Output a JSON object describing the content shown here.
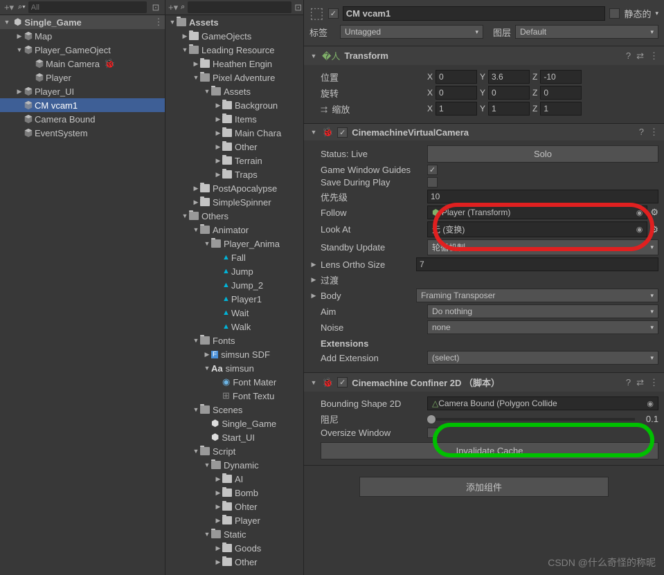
{
  "hierarchy": {
    "search_placeholder": "All",
    "scene": "Single_Game",
    "items": [
      {
        "name": "Map",
        "depth": 1,
        "arrow": "closed"
      },
      {
        "name": "Player_GameOject",
        "depth": 1,
        "arrow": "open"
      },
      {
        "name": "Main Camera",
        "depth": 2,
        "arrow": "none",
        "extra": "🐞"
      },
      {
        "name": "Player",
        "depth": 2,
        "arrow": "none"
      },
      {
        "name": "Player_UI",
        "depth": 1,
        "arrow": "closed"
      },
      {
        "name": "CM vcam1",
        "depth": 1,
        "arrow": "none",
        "selected": true
      },
      {
        "name": "Camera Bound",
        "depth": 1,
        "arrow": "none"
      },
      {
        "name": "EventSystem",
        "depth": 1,
        "arrow": "none"
      }
    ]
  },
  "project": {
    "root": "Assets",
    "tree": [
      {
        "name": "GameOjects",
        "d": 1,
        "a": "closed"
      },
      {
        "name": "Leading Resource",
        "d": 1,
        "a": "open"
      },
      {
        "name": "Heathen Engin",
        "d": 2,
        "a": "closed"
      },
      {
        "name": "Pixel Adventure",
        "d": 2,
        "a": "open"
      },
      {
        "name": "Assets",
        "d": 3,
        "a": "open"
      },
      {
        "name": "Backgroun",
        "d": 4,
        "a": "closed"
      },
      {
        "name": "Items",
        "d": 4,
        "a": "closed"
      },
      {
        "name": "Main Chara",
        "d": 4,
        "a": "closed"
      },
      {
        "name": "Other",
        "d": 4,
        "a": "closed"
      },
      {
        "name": "Terrain",
        "d": 4,
        "a": "closed"
      },
      {
        "name": "Traps",
        "d": 4,
        "a": "closed"
      },
      {
        "name": "PostApocalypse",
        "d": 2,
        "a": "closed"
      },
      {
        "name": "SimpleSpinner",
        "d": 2,
        "a": "closed"
      },
      {
        "name": "Others",
        "d": 1,
        "a": "open"
      },
      {
        "name": "Animator",
        "d": 2,
        "a": "open"
      },
      {
        "name": "Player_Anima",
        "d": 3,
        "a": "open"
      },
      {
        "name": "Fall",
        "d": 4,
        "a": "none",
        "icon": "anim"
      },
      {
        "name": "Jump",
        "d": 4,
        "a": "none",
        "icon": "anim"
      },
      {
        "name": "Jump_2",
        "d": 4,
        "a": "none",
        "icon": "anim"
      },
      {
        "name": "Player1",
        "d": 4,
        "a": "none",
        "icon": "anim"
      },
      {
        "name": "Wait",
        "d": 4,
        "a": "none",
        "icon": "anim"
      },
      {
        "name": "Walk",
        "d": 4,
        "a": "none",
        "icon": "anim"
      },
      {
        "name": "Fonts",
        "d": 2,
        "a": "open"
      },
      {
        "name": "simsun SDF",
        "d": 3,
        "a": "closed",
        "icon": "font"
      },
      {
        "name": "simsun",
        "d": 3,
        "a": "open",
        "icon": "aa"
      },
      {
        "name": "Font Mater",
        "d": 4,
        "a": "none",
        "icon": "mat"
      },
      {
        "name": "Font Textu",
        "d": 4,
        "a": "none",
        "icon": "tex"
      },
      {
        "name": "Scenes",
        "d": 2,
        "a": "open"
      },
      {
        "name": "Single_Game",
        "d": 3,
        "a": "none",
        "icon": "scene"
      },
      {
        "name": "Start_UI",
        "d": 3,
        "a": "none",
        "icon": "scene"
      },
      {
        "name": "Script",
        "d": 2,
        "a": "open"
      },
      {
        "name": "Dynamic",
        "d": 3,
        "a": "open"
      },
      {
        "name": "AI",
        "d": 4,
        "a": "closed"
      },
      {
        "name": "Bomb",
        "d": 4,
        "a": "closed"
      },
      {
        "name": "Ohter",
        "d": 4,
        "a": "closed"
      },
      {
        "name": "Player",
        "d": 4,
        "a": "closed"
      },
      {
        "name": "Static",
        "d": 3,
        "a": "open"
      },
      {
        "name": "Goods",
        "d": 4,
        "a": "closed"
      },
      {
        "name": "Other",
        "d": 4,
        "a": "closed"
      }
    ]
  },
  "inspector": {
    "object_name": "CM vcam1",
    "static_label": "静态的",
    "tag_label": "标签",
    "tag_value": "Untagged",
    "layer_label": "图层",
    "layer_value": "Default",
    "transform": {
      "title": "Transform",
      "pos_label": "位置",
      "rot_label": "旋转",
      "scale_label": "缩放",
      "pos": {
        "x": "0",
        "y": "3.6",
        "z": "-10"
      },
      "rot": {
        "x": "0",
        "y": "0",
        "z": "0"
      },
      "scale": {
        "x": "1",
        "y": "1",
        "z": "1"
      }
    },
    "vcam": {
      "title": "CinemachineVirtualCamera",
      "status_label": "Status: Live",
      "solo": "Solo",
      "guides_label": "Game Window Guides",
      "save_label": "Save During Play",
      "priority_label": "优先级",
      "priority": "10",
      "follow_label": "Follow",
      "follow_value": "Player (Transform)",
      "lookat_label": "Look At",
      "lookat_value": "无 (变换)",
      "standby_label": "Standby Update",
      "standby_value": "轮循机制",
      "lens_label": "Lens Ortho Size",
      "lens_value": "7",
      "transitions_label": "过渡",
      "body_label": "Body",
      "body_value": "Framing Transposer",
      "aim_label": "Aim",
      "aim_value": "Do nothing",
      "noise_label": "Noise",
      "noise_value": "none",
      "ext_title": "Extensions",
      "addext_label": "Add Extension",
      "addext_value": "(select)"
    },
    "confiner": {
      "title": "Cinemachine Confiner 2D （脚本）",
      "bounds_label": "Bounding Shape 2D",
      "bounds_value": "Camera Bound (Polygon Collide",
      "damping_label": "阻尼",
      "damping_value": "0.1",
      "oversize_label": "Oversize Window",
      "invalidate": "Invalidate Cache"
    },
    "add_component": "添加组件"
  },
  "watermark": "CSDN @什么奇怪的称昵"
}
